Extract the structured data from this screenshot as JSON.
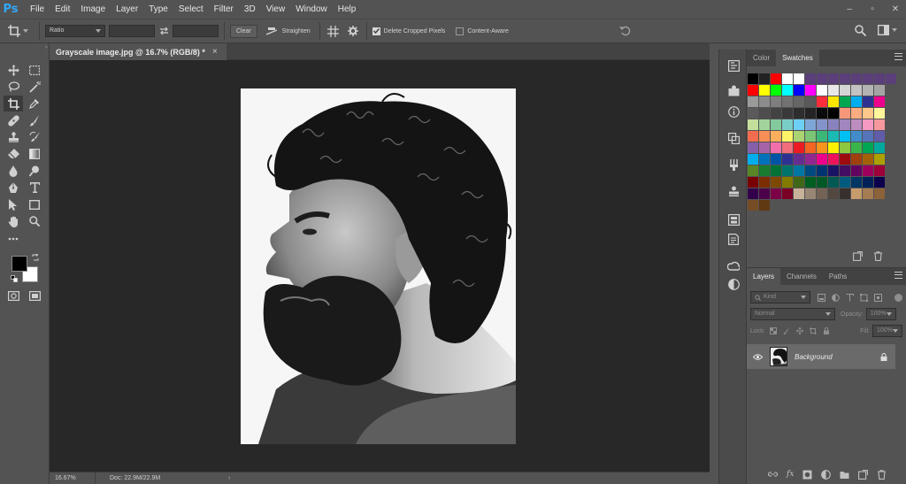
{
  "app": {
    "logo": "Ps"
  },
  "menu": [
    "File",
    "Edit",
    "Image",
    "Layer",
    "Type",
    "Select",
    "Filter",
    "3D",
    "View",
    "Window",
    "Help"
  ],
  "window_controls": [
    "–",
    "▫",
    "✕"
  ],
  "options": {
    "ratio": "Ratio",
    "clear_label": "Clear",
    "straighten_label": "Straighten",
    "delete_cropped_label": "Delete Cropped Pixels",
    "delete_cropped_checked": true,
    "content_aware_label": "Content-Aware",
    "content_aware_checked": false
  },
  "document": {
    "tab_title": "Grayscale image.jpg @ 16.7% (RGB/8) *",
    "tab_close": "×",
    "zoom": "16.67%",
    "doc_info": "Doc: 22.9M/22.9M",
    "status_arrow": "›"
  },
  "color_panel": {
    "tabs": [
      "Color",
      "Swatches"
    ],
    "active_tab": "Swatches"
  },
  "swatches": [
    [
      "#000000",
      "#222222",
      "#ff0000",
      "#ffffff",
      "#ffffff",
      "#5a3f7a",
      "#5a3f7a",
      "#5a3f7a",
      "#5a3f7a",
      "#5a3f7a",
      "#5a3f7a",
      "#5a3f7a",
      "#5a3f7a"
    ],
    [
      "#ff0000",
      "#ffff00",
      "#00ff00",
      "#00ffff",
      "#0000ff",
      "#ff00ff",
      "#ffffff",
      "#e8e8e8",
      "#d4d4d4",
      "#c2c2c2",
      "#b3b3b3",
      "#a4a4a4"
    ],
    [
      "#9a9a9a",
      "#8c8c8c",
      "#7e7e7e",
      "#727272",
      "#666666",
      "#595959",
      "#fd2e3a",
      "#ffe600",
      "#00a650",
      "#00adef",
      "#2e3192",
      "#ec008c"
    ],
    [
      "#5a5a5a",
      "#4d4d4d",
      "#434343",
      "#393939",
      "#2d2d2d",
      "#242424",
      "#0b0b0b",
      "#000000",
      "#f7977a",
      "#f9ad81",
      "#fdc68a",
      "#fff79a"
    ],
    [
      "#c4df9b",
      "#a3d39c",
      "#82ca9d",
      "#7bcdc8",
      "#6ecff6",
      "#7ea7d8",
      "#8493ca",
      "#8882be",
      "#a187be",
      "#bc8dbf",
      "#f49ac2",
      "#f6989d"
    ],
    [
      "#f26c4f",
      "#f68e55",
      "#fbaf5c",
      "#fff467",
      "#acd372",
      "#7cc576",
      "#3bb878",
      "#1abbb4",
      "#00bff3",
      "#438ccb",
      "#5574b9",
      "#605ca8"
    ],
    [
      "#8560a8",
      "#a763a8",
      "#f06eaa",
      "#f26d7d",
      "#ed1c24",
      "#f26522",
      "#f7941d",
      "#fff200",
      "#8dc63f",
      "#39b54a",
      "#00a651",
      "#00a99d"
    ],
    [
      "#00aeef",
      "#0072bc",
      "#0054a6",
      "#2e3192",
      "#662d91",
      "#92278f",
      "#ec008c",
      "#ed145b",
      "#9e0b0f",
      "#a0410d",
      "#a36209",
      "#aba000"
    ],
    [
      "#598527",
      "#197b30",
      "#007236",
      "#00746b",
      "#0076a3",
      "#004a80",
      "#003471",
      "#1b1464",
      "#440e62",
      "#630460",
      "#9e005d",
      "#9e0039"
    ],
    [
      "#790000",
      "#7b2e00",
      "#7d4900",
      "#827b00",
      "#406618",
      "#005e20",
      "#005826",
      "#005952",
      "#005b7f",
      "#003663",
      "#002157",
      "#0d004c"
    ],
    [
      "#32004b",
      "#4b0049",
      "#7b0046",
      "#7a0026",
      "#c7b299",
      "#998675",
      "#736357",
      "#534741",
      "#37302d",
      "#c69c6d",
      "#a67c52",
      "#8c6239"
    ],
    [
      "#754c24",
      "#603913"
    ]
  ],
  "layers_panel": {
    "tabs": [
      "Layers",
      "Channels",
      "Paths"
    ],
    "active_tab": "Layers",
    "kind_label": "Kind",
    "blend_mode": "Normal",
    "opacity_label": "Opacity:",
    "opacity_value": "100%",
    "lock_label": "Lock:",
    "fill_label": "Fill:",
    "fill_value": "100%",
    "layers": [
      {
        "name": "Background",
        "visible": true,
        "locked": true
      }
    ]
  }
}
